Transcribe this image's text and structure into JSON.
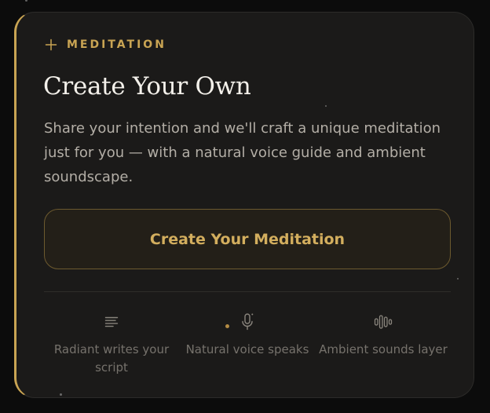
{
  "card": {
    "eyebrow": "MEDITATION",
    "title": "Create Your Own",
    "description": "Share your intention and we'll craft a unique meditation just for you — with a natural voice guide and ambient soundscape.",
    "cta_label": "Create Your Meditation"
  },
  "features": [
    {
      "icon": "text-lines-icon",
      "label": "Radiant writes your script"
    },
    {
      "icon": "microphone-icon",
      "label": "Natural voice speaks"
    },
    {
      "icon": "sound-bars-icon",
      "label": "Ambient sounds layer"
    }
  ],
  "colors": {
    "background": "#0c0c0c",
    "card": "#1b1a19",
    "accent_gold": "#c9a453",
    "title": "#f3f0ea",
    "body_text": "#b3aea6",
    "muted_text": "#76726c"
  }
}
